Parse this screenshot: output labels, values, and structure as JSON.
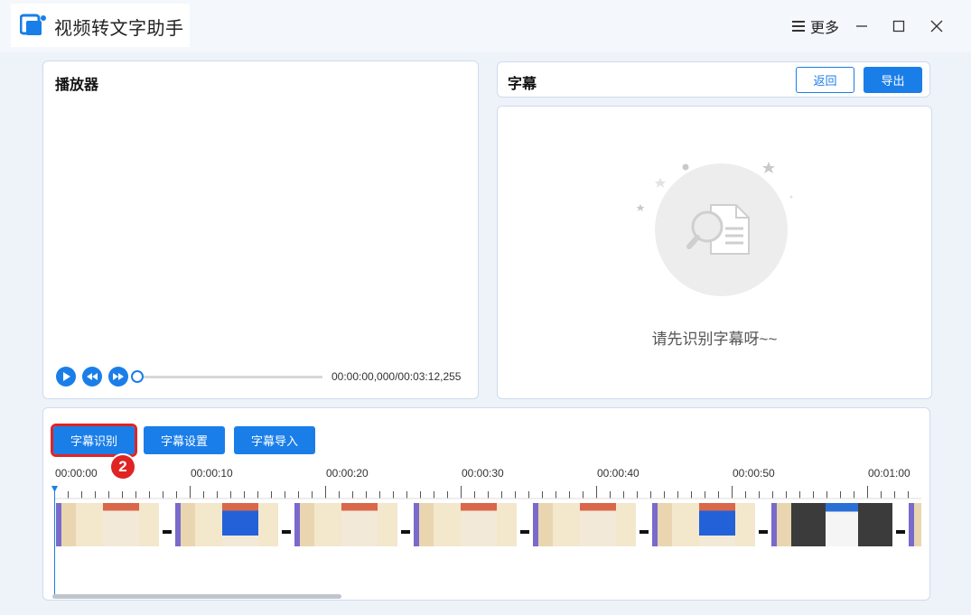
{
  "app": {
    "title": "视频转文字助手"
  },
  "window": {
    "more_label": "更多"
  },
  "player": {
    "title": "播放器",
    "time": "00:00:00,000/00:03:12,255",
    "progress": 0.0
  },
  "subtitle": {
    "title": "字幕",
    "back_label": "返回",
    "export_label": "导出",
    "empty_text": "请先识别字幕呀~~"
  },
  "toolbar": {
    "recognize_label": "字幕识别",
    "settings_label": "字幕设置",
    "import_label": "字幕导入",
    "step_badge": "2"
  },
  "timeline": {
    "ticks": [
      "00:00:00",
      "00:00:10",
      "00:00:20",
      "00:00:30",
      "00:00:40",
      "00:00:50",
      "00:01:00"
    ]
  },
  "colors": {
    "accent": "#1a7ee8",
    "highlight": "#e02424"
  }
}
